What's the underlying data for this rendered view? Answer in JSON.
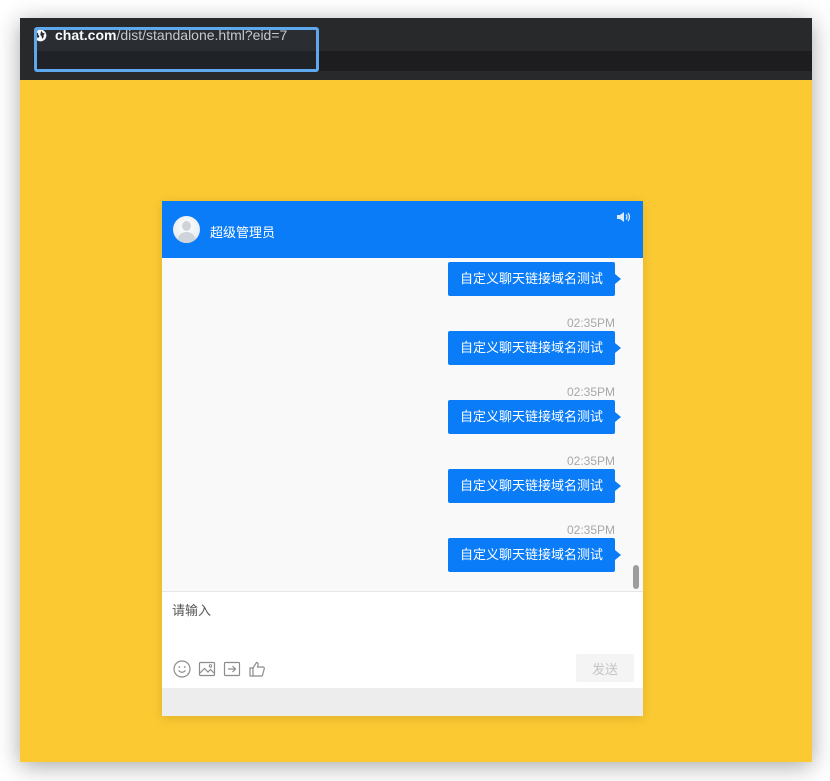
{
  "browser": {
    "url_host": "chat.com",
    "url_path": "/dist/standalone.html?eid=7"
  },
  "chat": {
    "agent_name": "超级管理员",
    "messages": [
      {
        "time": "",
        "text": "自定义聊天链接域名测试"
      },
      {
        "time": "02:35PM",
        "text": "自定义聊天链接域名测试"
      },
      {
        "time": "02:35PM",
        "text": "自定义聊天链接域名测试"
      },
      {
        "time": "02:35PM",
        "text": "自定义聊天链接域名测试"
      },
      {
        "time": "02:35PM",
        "text": "自定义聊天链接域名测试"
      }
    ],
    "input_placeholder": "请输入",
    "send_label": "发送",
    "tools": [
      "smiley-icon",
      "image-icon",
      "transfer-icon",
      "thumbs-up-icon"
    ]
  },
  "colors": {
    "page_background": "#fbc932",
    "header_blue": "#0a7cf7",
    "titlebar": "#28292b",
    "highlight_border": "#5fa8ee"
  }
}
